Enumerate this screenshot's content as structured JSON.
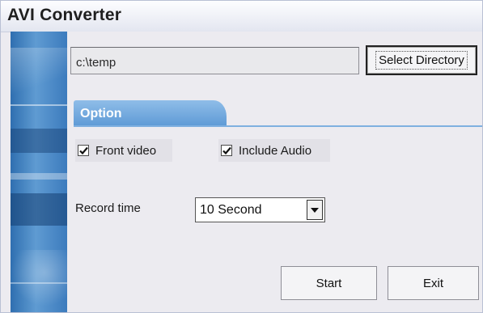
{
  "window": {
    "title": "AVI Converter"
  },
  "directory": {
    "path_value": "c:\\temp",
    "select_button_label": "Select Directory"
  },
  "option_tab": {
    "label": "Option"
  },
  "options": {
    "front_video": {
      "label": "Front video",
      "checked": true
    },
    "include_audio": {
      "label": "Include Audio",
      "checked": true
    }
  },
  "record": {
    "label": "Record time",
    "selected_value": "10 Second"
  },
  "actions": {
    "start_label": "Start",
    "exit_label": "Exit"
  },
  "colors": {
    "tab_accent": "#5e9ad6",
    "sidebar_blue": "#2f6fb0",
    "panel_background": "#ecebf0"
  },
  "icons": {
    "checkbox_mark": "checkmark-icon",
    "dropdown_arrow": "chevron-down-icon"
  }
}
